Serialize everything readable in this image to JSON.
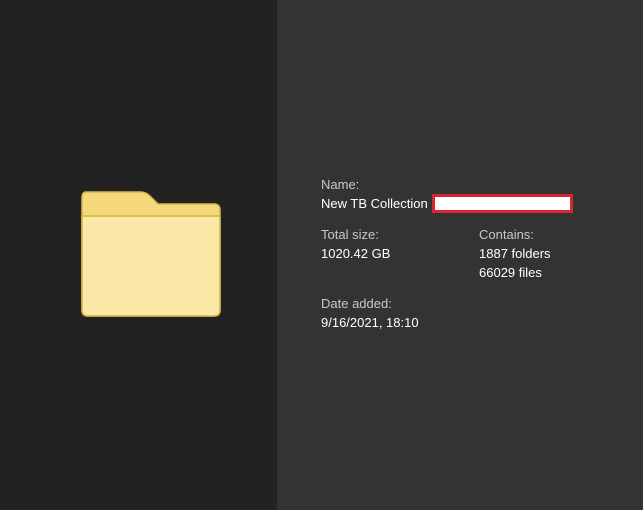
{
  "details": {
    "name_label": "Name:",
    "name_value": "New TB Collection",
    "total_size_label": "Total size:",
    "total_size_value": "1020.42 GB",
    "contains_label": "Contains:",
    "contains_folders": "1887 folders",
    "contains_files": "66029 files",
    "date_added_label": "Date added:",
    "date_added_value": "9/16/2021, 18:10"
  },
  "icons": {
    "folder": "folder-icon"
  },
  "colors": {
    "left_pane": "#222222",
    "right_pane": "#333333",
    "folder_fill": "#FBE8A6",
    "folder_tab": "#F4D97A",
    "folder_stroke": "#D9B649",
    "redaction_border": "#D9262C"
  }
}
